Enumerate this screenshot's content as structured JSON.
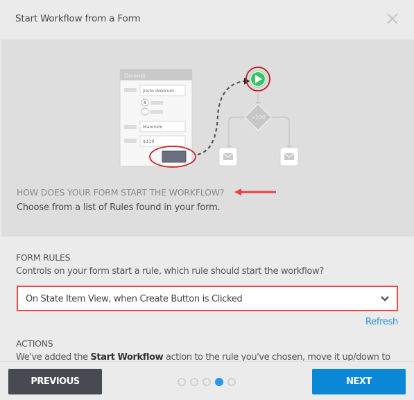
{
  "dialog": {
    "title": "Start Workflow from a Form",
    "close_icon": "close-icon"
  },
  "hero": {
    "illustration": {
      "form_title": "Delendi",
      "field1_value": "Justo dolorum",
      "field2_value": "Maiorum",
      "field3_value": "$110",
      "condition_label": ">100"
    },
    "question": "HOW DOES YOUR FORM START THE WORKFLOW?",
    "description": "Choose from a list of Rules found in your form."
  },
  "form_rules": {
    "label": "FORM RULES",
    "description": "Controls on your form start a rule, which rule should start the workflow?",
    "selected_rule": "On State Item View, when Create Button is Clicked",
    "refresh_label": "Refresh"
  },
  "actions": {
    "label": "ACTIONS",
    "desc_prefix": "We've added the ",
    "desc_bold": "Start Workflow",
    "desc_suffix": " action to the rule you've chosen, move it up/down to"
  },
  "footer": {
    "previous_label": "PREVIOUS",
    "next_label": "NEXT",
    "pager": {
      "total": 5,
      "current": 4
    }
  },
  "colors": {
    "highlight_red": "#e84a4a",
    "primary_blue": "#0a87d6",
    "link_blue": "#2b8fd9",
    "dark_button": "#474a51",
    "play_green": "#3cc06a"
  }
}
